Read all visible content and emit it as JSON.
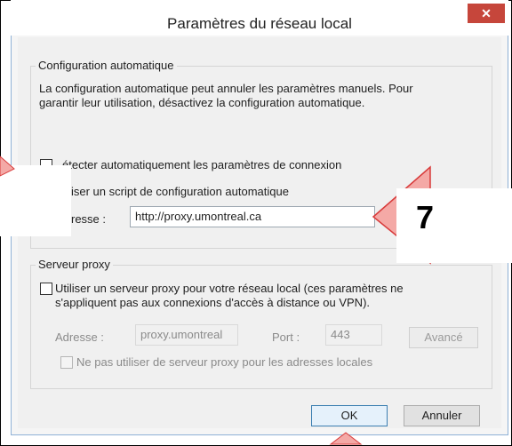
{
  "window": {
    "title": "Paramètres du réseau local",
    "close_glyph": "✕"
  },
  "auto_config": {
    "legend": "Configuration automatique",
    "description_line1": "La configuration automatique peut annuler les paramètres manuels. Pour",
    "description_line2": "garantir leur utilisation, désactivez la configuration automatique.",
    "detect_label": "étecter automatiquement les paramètres de connexion",
    "script_label": "iser un script de configuration automatique",
    "address_label": "resse :",
    "address_value": "http://proxy.umontreal.ca"
  },
  "proxy": {
    "legend": "Serveur proxy",
    "use_proxy_line1": "Utiliser un serveur proxy pour votre réseau local (ces paramètres ne",
    "use_proxy_line2": "s'appliquent pas aux connexions d'accès à distance ou VPN).",
    "address_label": "Adresse :",
    "address_value": "proxy.umontreal",
    "port_label": "Port :",
    "port_value": "443",
    "advanced_label": "Avancé",
    "bypass_label": "Ne pas utiliser de serveur proxy pour les adresses locales"
  },
  "buttons": {
    "ok": "OK",
    "cancel": "Annuler"
  },
  "annotation": {
    "step_number": "7",
    "arrow_color": "#f4a9a6",
    "arrow_border": "#d83a3a"
  }
}
